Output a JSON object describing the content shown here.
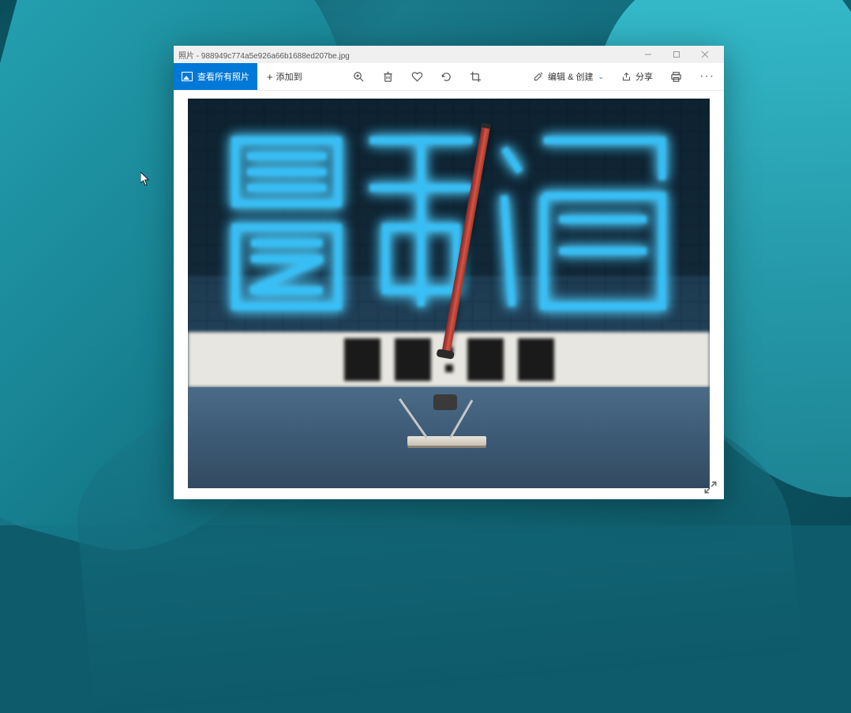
{
  "window": {
    "title_prefix": "照片",
    "filename": "988949c774a5e926a66b1688ed207be.jpg"
  },
  "toolbar": {
    "view_all_label": "查看所有照片",
    "add_to_label": "添加到",
    "edit_create_label": "编辑 & 创建",
    "share_label": "分享",
    "more_label": "···"
  },
  "icons": {
    "zoom": "zoom-icon",
    "delete": "delete-icon",
    "favorite": "heart-icon",
    "rotate": "rotate-icon",
    "crop": "crop-icon",
    "edit": "edit-pencil-icon",
    "share": "share-icon",
    "print": "print-icon",
    "fullscreen": "fullscreen-icon",
    "picture": "picture-icon",
    "plus": "plus-icon",
    "chevron_down": "chevron-down-icon",
    "minimize": "minimize-icon",
    "maximize": "maximize-icon",
    "close": "close-icon"
  }
}
